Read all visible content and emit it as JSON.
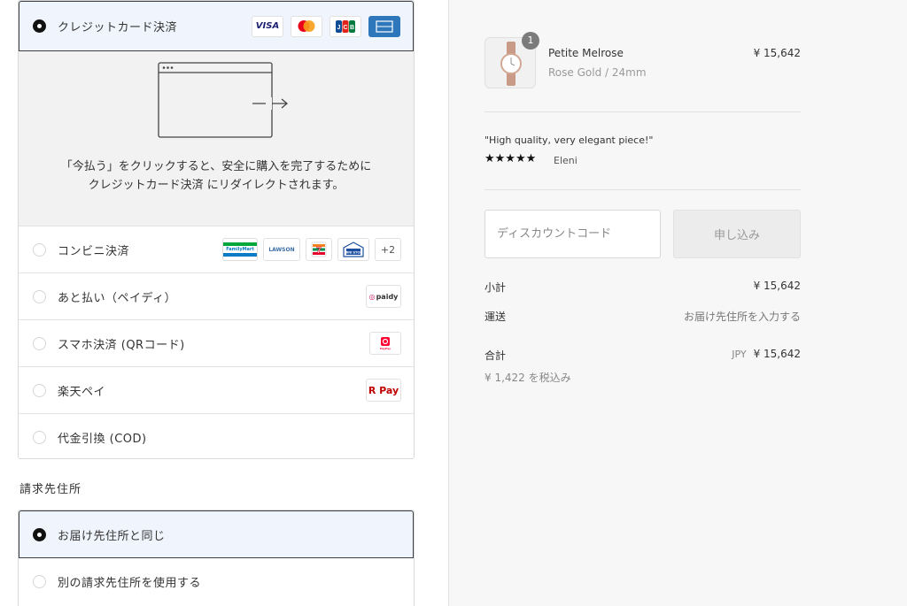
{
  "payment": {
    "selected_method": "クレジットカード決済",
    "card_logos": [
      "VISA",
      "Mastercard",
      "JCB",
      "AMEX"
    ],
    "redirect_message": "「今払う」をクリックすると、安全に購入を完了するために クレジットカード決済 にリダイレクトされます。",
    "methods": [
      {
        "label": "コンビニ決済",
        "logos": [
          "FamilyMart",
          "LAWSON",
          "7-Eleven",
          "MINI STOP"
        ],
        "more": "+2"
      },
      {
        "label": "あと払い（ペイディ）",
        "logos": [
          "paidy"
        ]
      },
      {
        "label": "スマホ決済 (QRコード)",
        "logos": [
          "PayPay"
        ]
      },
      {
        "label": "楽天ペイ",
        "logos": [
          "R Pay"
        ]
      },
      {
        "label": "代金引換 (COD)",
        "logos": []
      }
    ]
  },
  "billing": {
    "title": "請求先住所",
    "options": [
      "お届け先住所と同じ",
      "別の請求先住所を使用する"
    ]
  },
  "summary": {
    "product": {
      "name": "Petite Melrose",
      "variant": "Rose Gold / 24mm",
      "price": "¥ 15,642",
      "quantity": "1"
    },
    "review": {
      "quote": "\"High quality, very elegant piece!\"",
      "stars": "★★★★★",
      "author": "Eleni"
    },
    "discount": {
      "placeholder": "ディスカウントコード",
      "apply_label": "申し込み"
    },
    "subtotal_label": "小計",
    "subtotal_value": "¥ 15,642",
    "shipping_label": "運送",
    "shipping_value": "お届け先住所を入力する",
    "total_label": "合計",
    "total_currency": "JPY",
    "total_value": "¥ 15,642",
    "tax_note": "¥ 1,422 を税込み"
  },
  "colors": {
    "selected_bg": "#f0f4fc",
    "selected_border": "#3e3e44",
    "panel_bg": "#f2f2f2",
    "summary_bg": "#f7f7f7"
  }
}
